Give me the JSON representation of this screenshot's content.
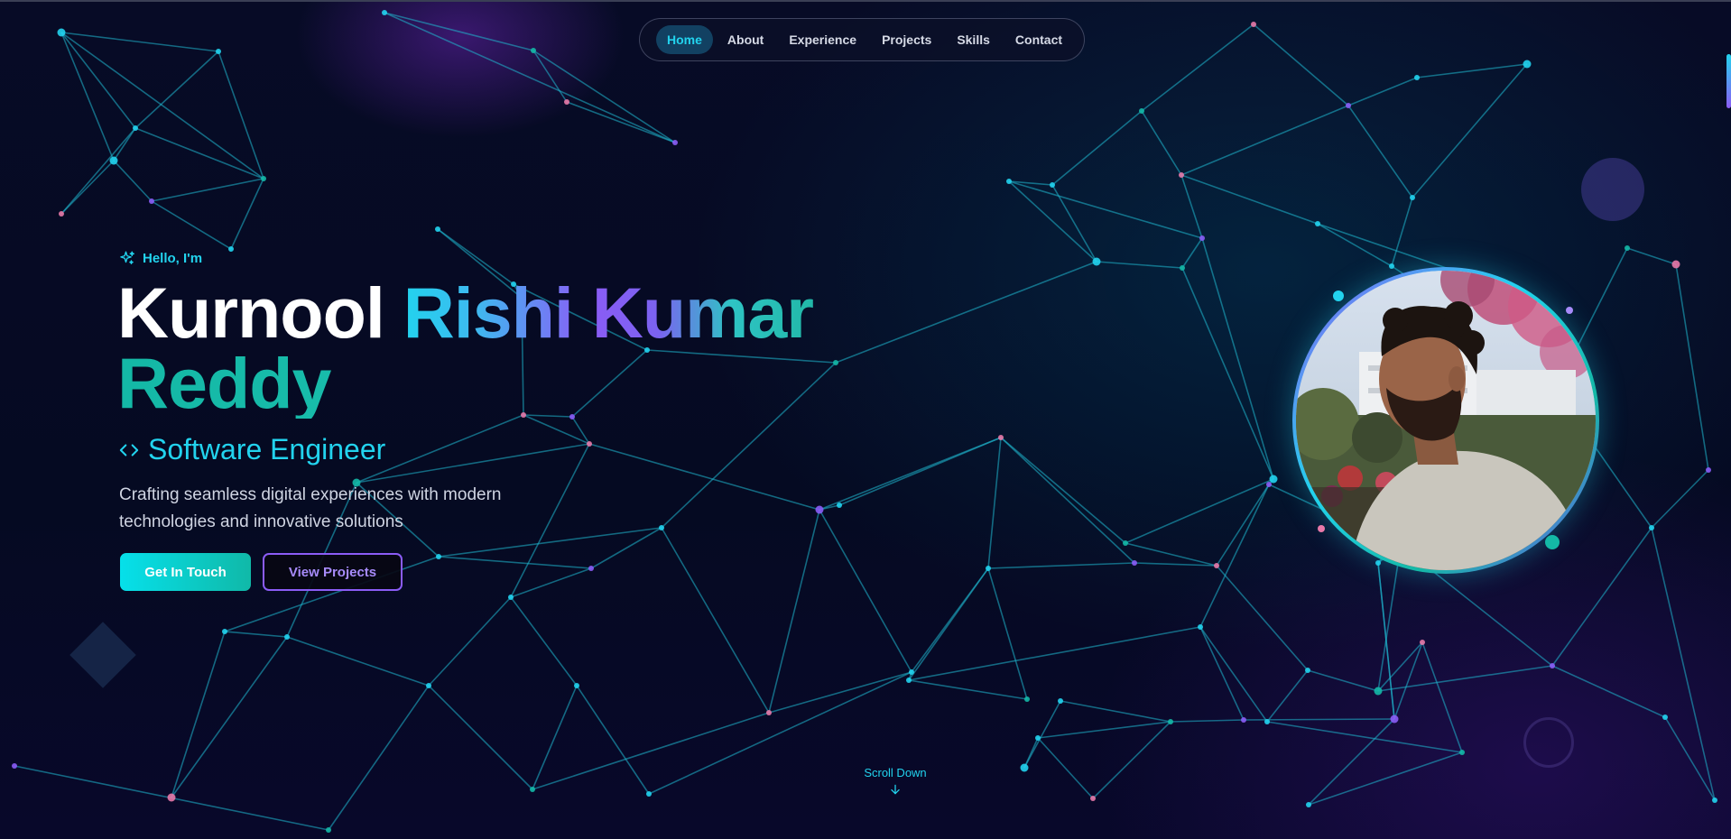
{
  "nav": {
    "items": [
      {
        "label": "Home",
        "active": true
      },
      {
        "label": "About",
        "active": false
      },
      {
        "label": "Experience",
        "active": false
      },
      {
        "label": "Projects",
        "active": false
      },
      {
        "label": "Skills",
        "active": false
      },
      {
        "label": "Contact",
        "active": false
      }
    ]
  },
  "hero": {
    "greeting": "Hello, I'm",
    "greeting_icon": "sparkle-icon",
    "name_first": "Kurnool",
    "name_middle": "Rishi Kumar",
    "name_last": "Reddy",
    "role_icon": "code-brackets-icon",
    "role": "Software Engineer",
    "tagline": "Crafting seamless digital experiences with modern technologies and innovative solutions",
    "primary_button": "Get In Touch",
    "secondary_button": "View Projects"
  },
  "scroll_hint": {
    "label": "Scroll Down",
    "icon": "arrow-down-icon"
  },
  "colors": {
    "accent_cyan": "#22d3ee",
    "accent_purple": "#8b5cf6",
    "accent_teal": "#14b8a6",
    "background": "#060a24"
  }
}
